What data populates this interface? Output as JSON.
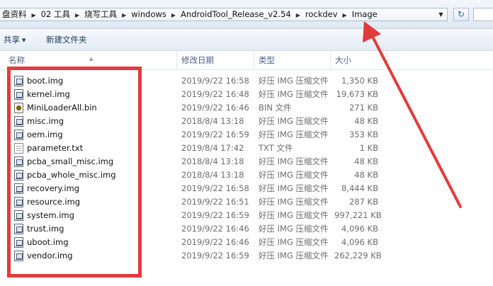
{
  "address_bar": {
    "crumbs": [
      "盘资料",
      "02 工具",
      "烧写工具",
      "windows",
      "AndroidTool_Release_v2.54",
      "rockdev",
      "Image"
    ]
  },
  "toolbar": {
    "share_label": "共享",
    "new_folder_label": "新建文件夹"
  },
  "columns": {
    "name": "名称",
    "date": "修改日期",
    "type": "类型",
    "size": "大小"
  },
  "files": [
    {
      "name": "boot.img",
      "date": "2019/9/22 16:58",
      "type": "好压 IMG 压缩文件",
      "size": "1,350 KB",
      "icon": "img-file-icon"
    },
    {
      "name": "kernel.img",
      "date": "2019/9/22 16:48",
      "type": "好压 IMG 压缩文件",
      "size": "19,673 KB",
      "icon": "img-file-icon"
    },
    {
      "name": "MiniLoaderAll.bin",
      "date": "2019/9/22 16:46",
      "type": "BIN 文件",
      "size": "271 KB",
      "icon": "bin-file-icon"
    },
    {
      "name": "misc.img",
      "date": "2018/8/4 13:18",
      "type": "好压 IMG 压缩文件",
      "size": "48 KB",
      "icon": "img-file-icon"
    },
    {
      "name": "oem.img",
      "date": "2019/9/22 16:59",
      "type": "好压 IMG 压缩文件",
      "size": "353 KB",
      "icon": "img-file-icon"
    },
    {
      "name": "parameter.txt",
      "date": "2019/8/4 17:42",
      "type": "TXT 文件",
      "size": "1 KB",
      "icon": "txt-file-icon"
    },
    {
      "name": "pcba_small_misc.img",
      "date": "2018/8/4 13:18",
      "type": "好压 IMG 压缩文件",
      "size": "48 KB",
      "icon": "img-file-icon"
    },
    {
      "name": "pcba_whole_misc.img",
      "date": "2018/8/4 13:18",
      "type": "好压 IMG 压缩文件",
      "size": "48 KB",
      "icon": "img-file-icon"
    },
    {
      "name": "recovery.img",
      "date": "2019/9/22 16:58",
      "type": "好压 IMG 压缩文件",
      "size": "8,444 KB",
      "icon": "img-file-icon"
    },
    {
      "name": "resource.img",
      "date": "2019/9/22 16:51",
      "type": "好压 IMG 压缩文件",
      "size": "287 KB",
      "icon": "img-file-icon"
    },
    {
      "name": "system.img",
      "date": "2019/9/22 16:59",
      "type": "好压 IMG 压缩文件",
      "size": "997,221 KB",
      "icon": "img-file-icon"
    },
    {
      "name": "trust.img",
      "date": "2019/9/22 16:46",
      "type": "好压 IMG 压缩文件",
      "size": "4,096 KB",
      "icon": "img-file-icon"
    },
    {
      "name": "uboot.img",
      "date": "2019/9/22 16:46",
      "type": "好压 IMG 压缩文件",
      "size": "4,096 KB",
      "icon": "img-file-icon"
    },
    {
      "name": "vendor.img",
      "date": "2019/9/22 16:59",
      "type": "好压 IMG 压缩文件",
      "size": "262,229 KB",
      "icon": "img-file-icon"
    }
  ],
  "annotation_color": "#e23b3b"
}
